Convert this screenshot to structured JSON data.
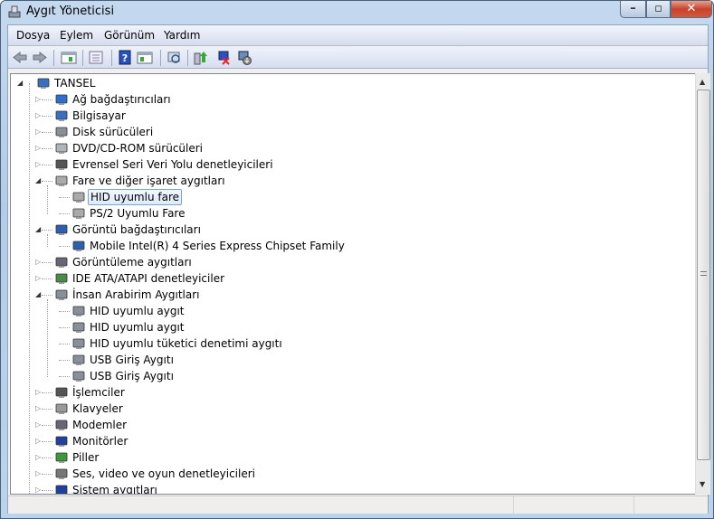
{
  "window": {
    "title": "Aygıt Yöneticisi",
    "minimize": "–",
    "maximize": "▫",
    "close": "✕"
  },
  "menu": [
    "Dosya",
    "Eylem",
    "Görünüm",
    "Yardım"
  ],
  "toolbar": [
    "back-icon",
    "forward-icon",
    "show-hide-console-tree-icon",
    "properties-icon",
    "help-icon",
    "show-action-pane-icon",
    "scan-hardware-icon",
    "update-driver-icon",
    "uninstall-icon",
    "disable-icon"
  ],
  "colors": {
    "selection_border": "#7da2ce",
    "close_button": "#c8432c"
  },
  "tree": [
    {
      "level": 0,
      "label": "TANSEL",
      "expanded": true,
      "icon": "computer-icon"
    },
    {
      "level": 1,
      "label": "Ağ bağdaştırıcıları",
      "icon": "network-adapter-icon"
    },
    {
      "level": 1,
      "label": "Bilgisayar",
      "icon": "computer-icon"
    },
    {
      "level": 1,
      "label": "Disk sürücüleri",
      "icon": "disk-drive-icon"
    },
    {
      "level": 1,
      "label": "DVD/CD-ROM sürücüleri",
      "icon": "dvd-icon"
    },
    {
      "level": 1,
      "label": "Evrensel Seri Veri Yolu denetleyicileri",
      "icon": "usb-icon"
    },
    {
      "level": 1,
      "label": "Fare ve diğer işaret aygıtları",
      "expanded": true,
      "icon": "mouse-icon"
    },
    {
      "level": 2,
      "label": "HID uyumlu fare",
      "selected": true,
      "icon": "mouse-icon"
    },
    {
      "level": 2,
      "label": "PS/2 Uyumlu Fare",
      "icon": "mouse-icon",
      "last": true
    },
    {
      "level": 1,
      "label": "Görüntü bağdaştırıcıları",
      "expanded": true,
      "icon": "display-adapter-icon"
    },
    {
      "level": 2,
      "label": "Mobile Intel(R) 4 Series Express Chipset Family",
      "icon": "display-adapter-icon",
      "last": true
    },
    {
      "level": 1,
      "label": "Görüntüleme aygıtları",
      "icon": "imaging-device-icon"
    },
    {
      "level": 1,
      "label": "IDE ATA/ATAPI denetleyiciler",
      "icon": "ide-controller-icon"
    },
    {
      "level": 1,
      "label": "İnsan Arabirim Aygıtları",
      "expanded": true,
      "icon": "hid-icon"
    },
    {
      "level": 2,
      "label": "HID uyumlu aygıt",
      "icon": "hid-icon"
    },
    {
      "level": 2,
      "label": "HID uyumlu aygıt",
      "icon": "hid-icon"
    },
    {
      "level": 2,
      "label": "HID uyumlu tüketici denetimi aygıtı",
      "icon": "hid-icon"
    },
    {
      "level": 2,
      "label": "USB Giriş Aygıtı",
      "icon": "hid-icon"
    },
    {
      "level": 2,
      "label": "USB Giriş Aygıtı",
      "icon": "hid-icon",
      "last": true
    },
    {
      "level": 1,
      "label": "İşlemciler",
      "icon": "processor-icon"
    },
    {
      "level": 1,
      "label": "Klavyeler",
      "icon": "keyboard-icon"
    },
    {
      "level": 1,
      "label": "Modemler",
      "icon": "modem-icon"
    },
    {
      "level": 1,
      "label": "Monitörler",
      "icon": "monitor-icon"
    },
    {
      "level": 1,
      "label": "Piller",
      "icon": "battery-icon"
    },
    {
      "level": 1,
      "label": "Ses, video ve oyun denetleyicileri",
      "icon": "speaker-icon"
    },
    {
      "level": 1,
      "label": "Sistem aygıtları",
      "icon": "system-device-icon"
    }
  ]
}
